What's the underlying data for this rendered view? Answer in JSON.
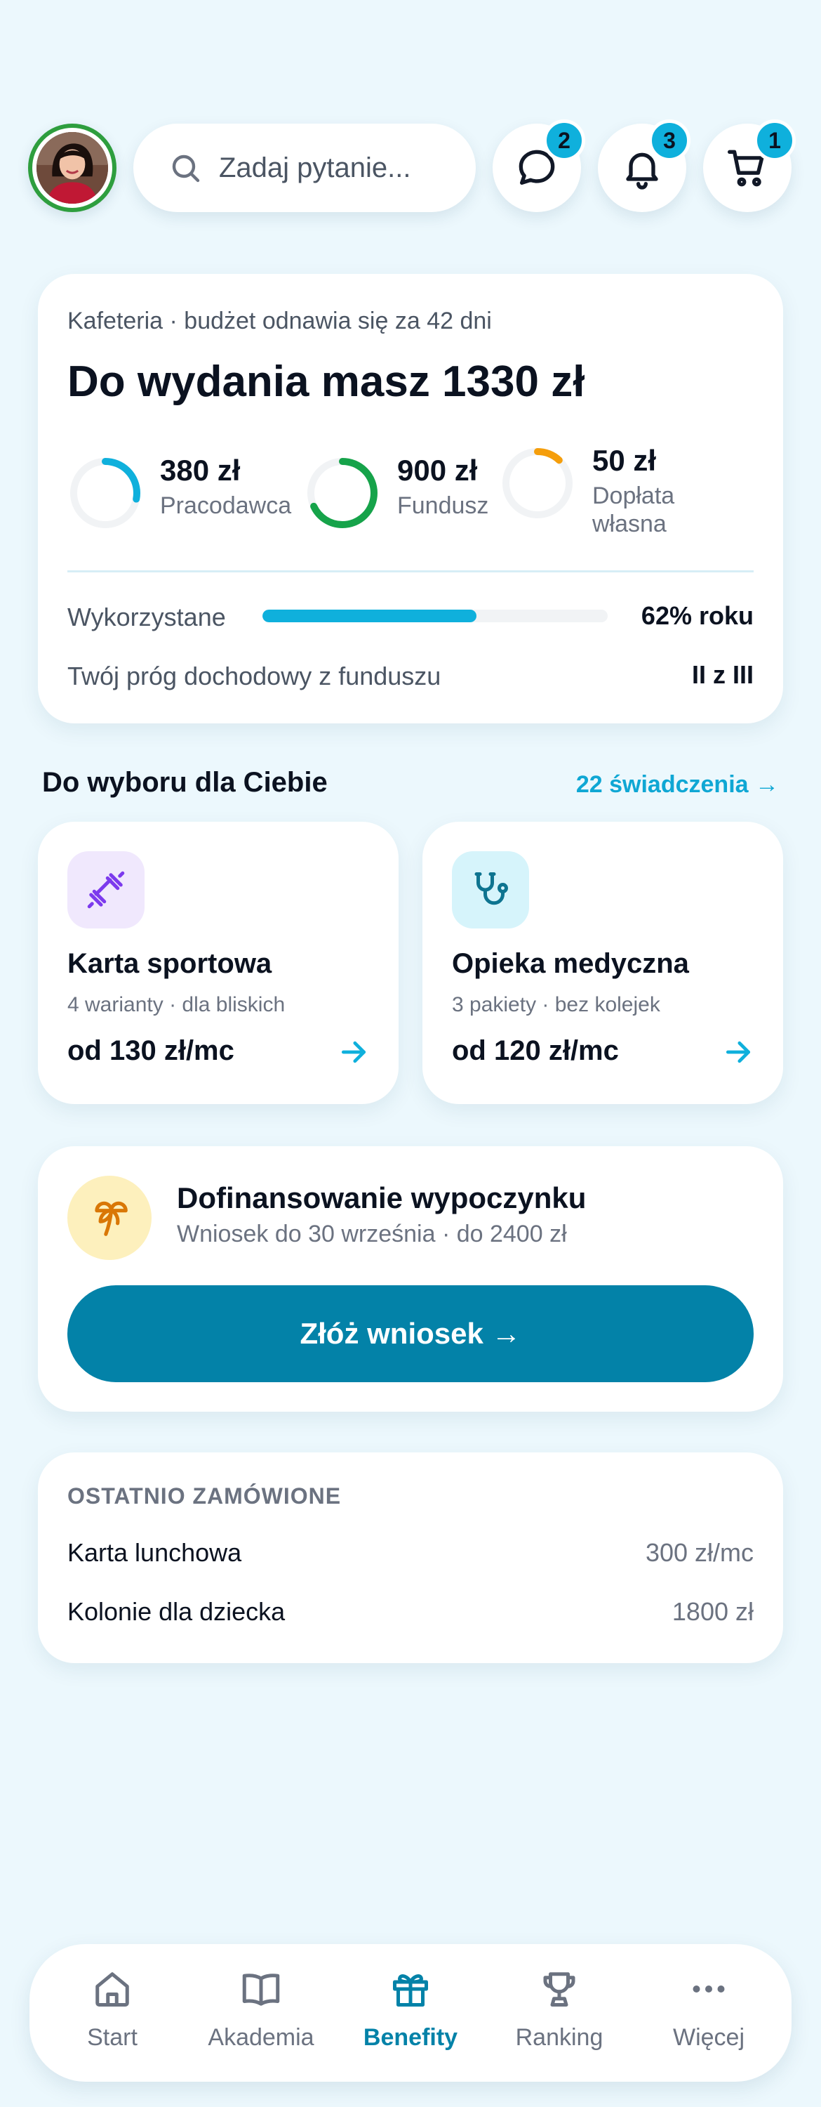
{
  "header": {
    "search_placeholder": "Zadaj pytanie...",
    "badges": {
      "messages": "2",
      "notifications": "3",
      "cart": "1"
    }
  },
  "budget": {
    "renew_text": "Kafeteria · budżet odnawia się za 42 dni",
    "title": "Do wydania masz 1330 zł",
    "sources": [
      {
        "value": "380 zł",
        "label": "Pracodawca",
        "fill": 0.28,
        "color": "#0fb0dc"
      },
      {
        "value": "900 zł",
        "label": "Fundusz",
        "fill": 0.68,
        "color": "#16a34a"
      },
      {
        "value": "50 zł",
        "label": "Dopłata własna",
        "fill": 0.12,
        "color": "#f59e0b"
      }
    ],
    "used_label": "Wykorzystane",
    "used_fraction": 0.62,
    "used_value": "62% roku",
    "threshold_label": "Twój próg dochodowy z funduszu",
    "threshold_value": "II z III"
  },
  "choices": {
    "title": "Do wyboru dla Ciebie",
    "link": "22 świadczenia →",
    "items": [
      {
        "name": "Karta sportowa",
        "sub": "4 warianty · dla bliskich",
        "price": "od 130 zł/mc",
        "icon": "dumbbell-icon",
        "color": "#7c3aed",
        "bg": "#f0e8fd"
      },
      {
        "name": "Opieka medyczna",
        "sub": "3 pakiety · bez kolejek",
        "price": "od 120 zł/mc",
        "icon": "stethoscope-icon",
        "color": "#0e7490",
        "bg": "#d6f4fb"
      }
    ]
  },
  "promo": {
    "title": "Dofinansowanie wypoczynku",
    "sub": "Wniosek do 30 września · do 2400 zł",
    "cta": "Złóż wniosek →",
    "icon": "palm-tree-icon"
  },
  "recent": {
    "title": "OSTATNIO ZAMÓWIONE",
    "items": [
      {
        "name": "Karta lunchowa",
        "value": "300 zł/mc"
      },
      {
        "name": "Kolonie dla dziecka",
        "value": "1800 zł"
      }
    ]
  },
  "nav": {
    "items": [
      {
        "label": "Start",
        "icon": "home-icon"
      },
      {
        "label": "Akademia",
        "icon": "book-icon"
      },
      {
        "label": "Benefity",
        "icon": "gift-icon"
      },
      {
        "label": "Ranking",
        "icon": "trophy-icon"
      },
      {
        "label": "Więcej",
        "icon": "more-icon"
      }
    ],
    "active": "Benefity"
  },
  "colors": {
    "accent": "#0fb0dc",
    "primary": "#0382a8",
    "background": "#ecf8fd"
  }
}
